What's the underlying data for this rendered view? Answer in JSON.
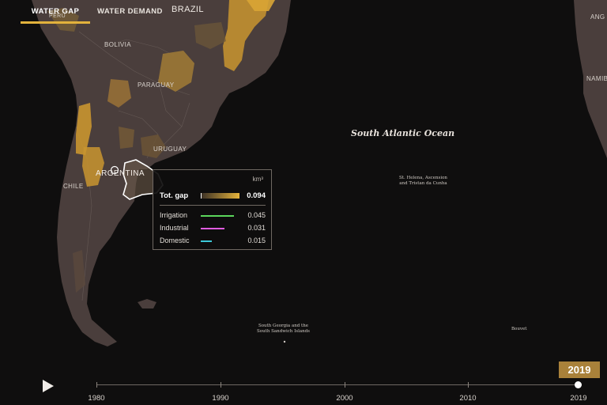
{
  "tabs": {
    "water_gap": "WATER GAP",
    "water_demand": "WATER DEMAND"
  },
  "map": {
    "countries": {
      "peru": "PERU",
      "brazil": "BRAZIL",
      "bolivia": "BOLIVIA",
      "paraguay": "PARAGUAY",
      "uruguay": "URUGUAY",
      "argentina": "ARGENTINA",
      "chile": "CHILE",
      "angola": "ANG",
      "namibia": "NAMIB"
    },
    "ocean": "South Atlantic Ocean",
    "islands": {
      "st_helena_1": "St. Helena, Ascension",
      "st_helena_2": "and Tristan da Cunha",
      "south_georgia_1": "South Georgia and the",
      "south_georgia_2": "South Sandwich Islands",
      "bouvet": "Bouvet"
    },
    "colors": {
      "land": "#4a3e3c",
      "highlight": "#c9952f",
      "ocean": "#0f0e0e"
    }
  },
  "tooltip": {
    "unit": "km³",
    "total_label": "Tot. gap",
    "total_value": "0.094",
    "rows": [
      {
        "label": "Irrigation",
        "value": "0.045",
        "color": "#5cd65c"
      },
      {
        "label": "Industrial",
        "value": "0.031",
        "color": "#e05ce0"
      },
      {
        "label": "Domestic",
        "value": "0.015",
        "color": "#3cc8d8"
      }
    ]
  },
  "timeline": {
    "ticks": [
      "1980",
      "1990",
      "2000",
      "2010",
      "2019"
    ],
    "current_year": "2019"
  }
}
